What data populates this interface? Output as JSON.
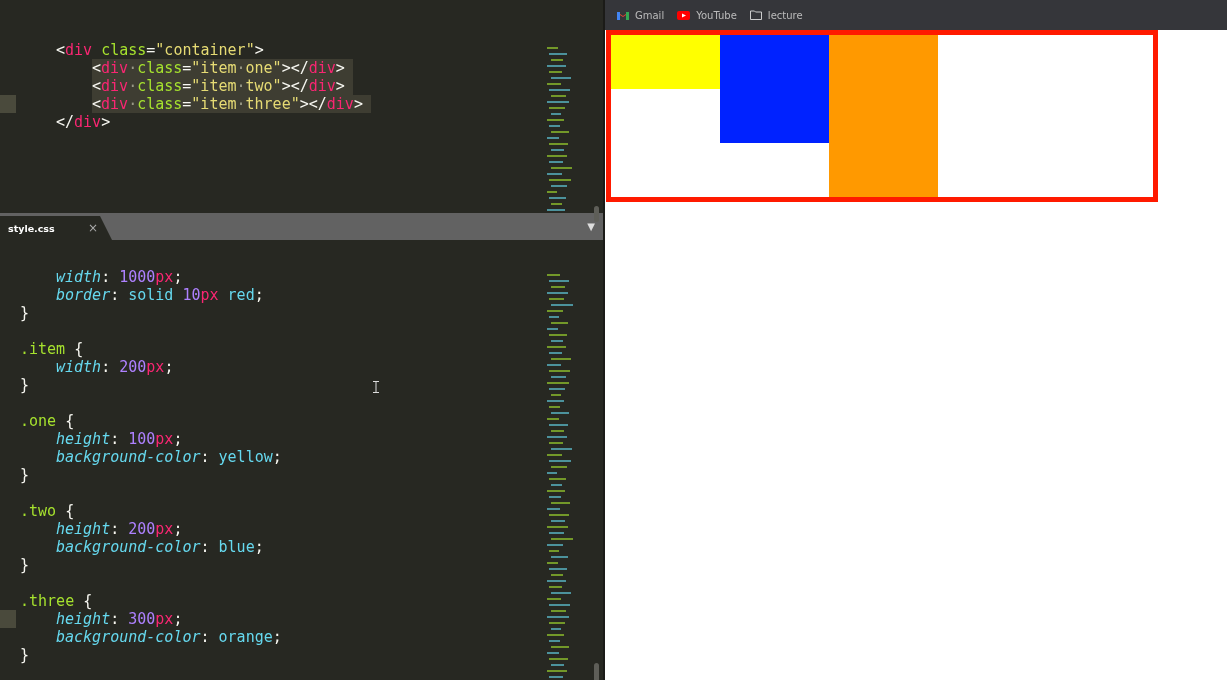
{
  "editor": {
    "top_pane": {
      "lines": [
        {
          "kind": "code",
          "selected": false,
          "current": false,
          "tokens": [
            {
              "kind": "punct",
              "text": "<"
            },
            {
              "kind": "tag",
              "text": "div"
            },
            {
              "kind": "attr",
              "text": " class"
            },
            {
              "kind": "punct",
              "text": "="
            },
            {
              "kind": "str",
              "text": "\"container\""
            },
            {
              "kind": "punct",
              "text": ">"
            }
          ],
          "children": [
            {
              "kind": "code",
              "selected": true,
              "current": false,
              "tokens": [
                {
                  "kind": "punct",
                  "text": "<"
                },
                {
                  "kind": "tag",
                  "text": "div"
                },
                {
                  "kind": "ws",
                  "text": "·"
                },
                {
                  "kind": "attr",
                  "text": "class"
                },
                {
                  "kind": "punct",
                  "text": "="
                },
                {
                  "kind": "str",
                  "text": "\"item"
                },
                {
                  "kind": "ws",
                  "text": "·"
                },
                {
                  "kind": "str",
                  "text": "one\""
                },
                {
                  "kind": "punct",
                  "text": "></"
                },
                {
                  "kind": "tag",
                  "text": "div"
                },
                {
                  "kind": "punct",
                  "text": ">"
                }
              ]
            },
            {
              "kind": "code",
              "selected": true,
              "current": false,
              "tokens": [
                {
                  "kind": "punct",
                  "text": "<"
                },
                {
                  "kind": "tag",
                  "text": "div"
                },
                {
                  "kind": "ws",
                  "text": "·"
                },
                {
                  "kind": "attr",
                  "text": "class"
                },
                {
                  "kind": "punct",
                  "text": "="
                },
                {
                  "kind": "str",
                  "text": "\"item"
                },
                {
                  "kind": "ws",
                  "text": "·"
                },
                {
                  "kind": "str",
                  "text": "two\""
                },
                {
                  "kind": "punct",
                  "text": "></"
                },
                {
                  "kind": "tag",
                  "text": "div"
                },
                {
                  "kind": "punct",
                  "text": ">"
                }
              ]
            },
            {
              "kind": "code",
              "selected": true,
              "current": true,
              "tokens": [
                {
                  "kind": "punct",
                  "text": "<"
                },
                {
                  "kind": "tag",
                  "text": "div"
                },
                {
                  "kind": "ws",
                  "text": "·"
                },
                {
                  "kind": "attr",
                  "text": "class"
                },
                {
                  "kind": "punct",
                  "text": "="
                },
                {
                  "kind": "str",
                  "text": "\"item"
                },
                {
                  "kind": "ws",
                  "text": "·"
                },
                {
                  "kind": "str",
                  "text": "three\""
                },
                {
                  "kind": "punct",
                  "text": "></"
                },
                {
                  "kind": "tag",
                  "text": "div"
                },
                {
                  "kind": "punct",
                  "text": ">"
                }
              ]
            }
          ]
        },
        {
          "kind": "code",
          "selected": false,
          "current": false,
          "tokens": [
            {
              "kind": "punct",
              "text": "</"
            },
            {
              "kind": "tag",
              "text": "div"
            },
            {
              "kind": "punct",
              "text": ">"
            }
          ]
        }
      ]
    },
    "tab": {
      "label": "style.css",
      "close": "×",
      "selected": true
    },
    "tab_menu": "▼",
    "bottom_pane": {
      "lines": [
        {
          "kind": "continuation",
          "children": [
            {
              "kind": "code",
              "current": false,
              "tokens": [
                {
                  "kind": "prop",
                  "text": "width"
                },
                {
                  "kind": "punct",
                  "text": ":"
                },
                {
                  "kind": "num",
                  "text": " 1000"
                },
                {
                  "kind": "unit",
                  "text": "px"
                },
                {
                  "kind": "punct",
                  "text": ";"
                }
              ]
            },
            {
              "kind": "code",
              "current": false,
              "tokens": [
                {
                  "kind": "prop",
                  "text": "border"
                },
                {
                  "kind": "punct",
                  "text": ":"
                },
                {
                  "kind": "val",
                  "text": " solid"
                },
                {
                  "kind": "num",
                  "text": " 10"
                },
                {
                  "kind": "unit",
                  "text": "px"
                },
                {
                  "kind": "val",
                  "text": " red"
                },
                {
                  "kind": "punct",
                  "text": ";"
                }
              ]
            }
          ]
        },
        {
          "kind": "code",
          "current": false,
          "tokens": [
            {
              "kind": "punct",
              "text": "}"
            }
          ]
        },
        {
          "kind": "blank"
        },
        {
          "kind": "code",
          "current": false,
          "tokens": [
            {
              "kind": "sel",
              "text": ".item"
            },
            {
              "kind": "punct",
              "text": " {"
            }
          ],
          "children": [
            {
              "kind": "code",
              "current": false,
              "tokens": [
                {
                  "kind": "prop",
                  "text": "width"
                },
                {
                  "kind": "punct",
                  "text": ":"
                },
                {
                  "kind": "num",
                  "text": " 200"
                },
                {
                  "kind": "unit",
                  "text": "px"
                },
                {
                  "kind": "punct",
                  "text": ";"
                }
              ]
            }
          ]
        },
        {
          "kind": "code",
          "current": false,
          "tokens": [
            {
              "kind": "punct",
              "text": "}"
            }
          ]
        },
        {
          "kind": "blank"
        },
        {
          "kind": "code",
          "current": false,
          "tokens": [
            {
              "kind": "sel",
              "text": ".one"
            },
            {
              "kind": "punct",
              "text": " {"
            }
          ],
          "children": [
            {
              "kind": "code",
              "current": false,
              "tokens": [
                {
                  "kind": "prop",
                  "text": "height"
                },
                {
                  "kind": "punct",
                  "text": ":"
                },
                {
                  "kind": "num",
                  "text": " 100"
                },
                {
                  "kind": "unit",
                  "text": "px"
                },
                {
                  "kind": "punct",
                  "text": ";"
                }
              ]
            },
            {
              "kind": "code",
              "current": false,
              "tokens": [
                {
                  "kind": "prop",
                  "text": "background-color"
                },
                {
                  "kind": "punct",
                  "text": ":"
                },
                {
                  "kind": "val",
                  "text": " yellow"
                },
                {
                  "kind": "punct",
                  "text": ";"
                }
              ]
            }
          ]
        },
        {
          "kind": "code",
          "current": false,
          "tokens": [
            {
              "kind": "punct",
              "text": "}"
            }
          ]
        },
        {
          "kind": "blank"
        },
        {
          "kind": "code",
          "current": false,
          "tokens": [
            {
              "kind": "sel",
              "text": ".two"
            },
            {
              "kind": "punct",
              "text": " {"
            }
          ],
          "children": [
            {
              "kind": "code",
              "current": false,
              "tokens": [
                {
                  "kind": "prop",
                  "text": "height"
                },
                {
                  "kind": "punct",
                  "text": ":"
                },
                {
                  "kind": "num",
                  "text": " 200"
                },
                {
                  "kind": "unit",
                  "text": "px"
                },
                {
                  "kind": "punct",
                  "text": ";"
                }
              ]
            },
            {
              "kind": "code",
              "current": false,
              "tokens": [
                {
                  "kind": "prop",
                  "text": "background-color"
                },
                {
                  "kind": "punct",
                  "text": ":"
                },
                {
                  "kind": "val",
                  "text": " blue"
                },
                {
                  "kind": "punct",
                  "text": ";"
                }
              ]
            }
          ]
        },
        {
          "kind": "code",
          "current": false,
          "tokens": [
            {
              "kind": "punct",
              "text": "}"
            }
          ]
        },
        {
          "kind": "blank"
        },
        {
          "kind": "code",
          "current": false,
          "tokens": [
            {
              "kind": "sel",
              "text": ".three"
            },
            {
              "kind": "punct",
              "text": " {"
            }
          ],
          "children": [
            {
              "kind": "code",
              "current": true,
              "tokens": [
                {
                  "kind": "prop",
                  "text": "height"
                },
                {
                  "kind": "punct",
                  "text": ":"
                },
                {
                  "kind": "num",
                  "text": " 300"
                },
                {
                  "kind": "unit",
                  "text": "px"
                },
                {
                  "kind": "punct",
                  "text": ";"
                }
              ]
            },
            {
              "kind": "code",
              "current": false,
              "tokens": [
                {
                  "kind": "prop",
                  "text": "background-color"
                },
                {
                  "kind": "punct",
                  "text": ":"
                },
                {
                  "kind": "val",
                  "text": " orange"
                },
                {
                  "kind": "punct",
                  "text": ";"
                }
              ]
            }
          ]
        },
        {
          "kind": "code",
          "current": false,
          "tokens": [
            {
              "kind": "punct",
              "text": "}"
            }
          ]
        }
      ]
    }
  },
  "browser": {
    "bookmarks": [
      {
        "kind": "gmail",
        "label": "Gmail"
      },
      {
        "kind": "youtube",
        "label": "YouTube"
      },
      {
        "kind": "folder",
        "label": "lecture"
      }
    ],
    "container": {
      "color": "#ff1a00",
      "items": [
        {
          "color": "#ffff00",
          "kind": "short"
        },
        {
          "color": "#0022ff",
          "kind": "medium"
        },
        {
          "color": "#ff9900",
          "kind": "tall"
        }
      ]
    }
  }
}
